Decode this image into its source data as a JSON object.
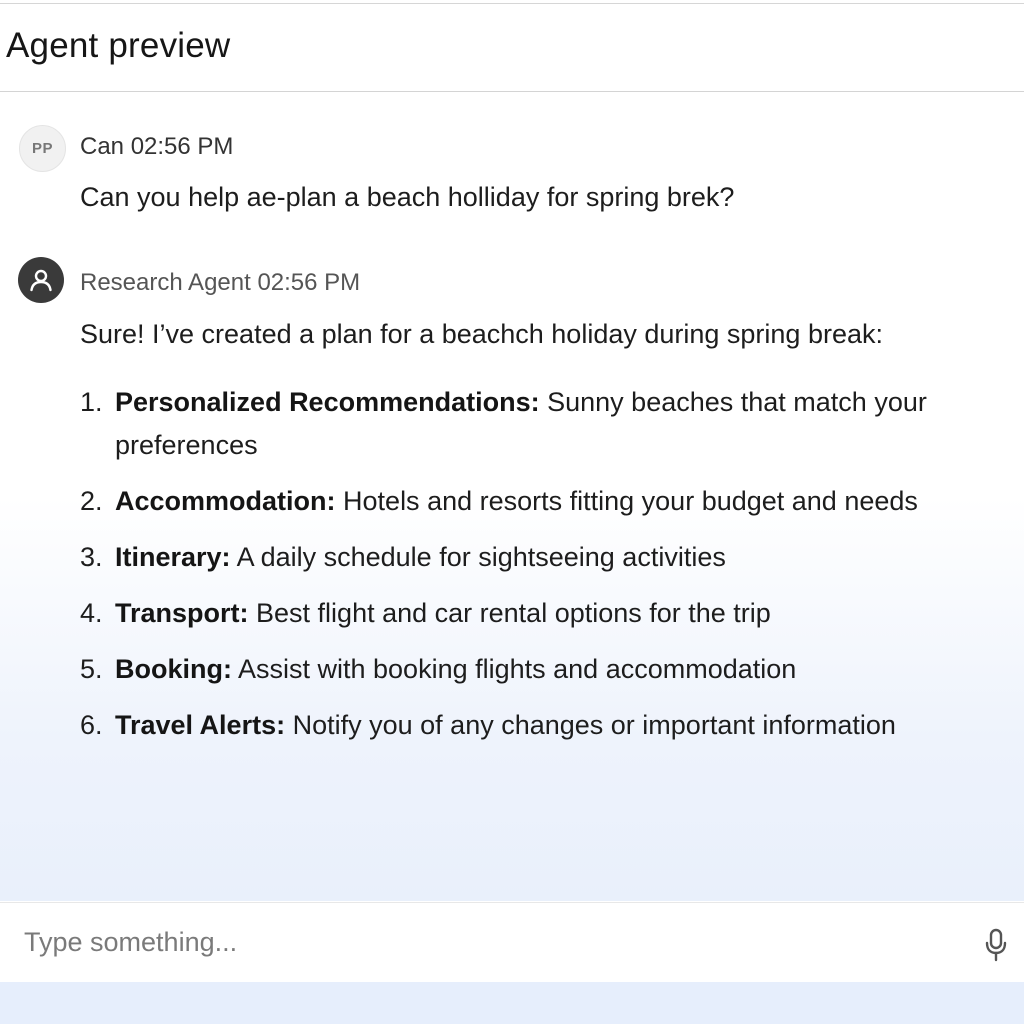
{
  "header": {
    "title": "Agent preview"
  },
  "messages": {
    "user": {
      "avatar_initials": "PP",
      "meta": "Can 02:56 PM",
      "text": "Can you help ae-plan a beach holliday for spring brek?"
    },
    "agent": {
      "avatar_icon": "person-icon",
      "meta": "Research Agent 02:56 PM",
      "intro": "Sure! I’ve created a plan for a beachch holiday during spring break:",
      "items": [
        {
          "num": "1.",
          "title": "Personalized Recommendations:",
          "text": "Sunny beaches that match your preferences"
        },
        {
          "num": "2.",
          "title": "Accommodation:",
          "text": "Hotels and resorts fitting your budget and needs"
        },
        {
          "num": "3.",
          "title": "Itinerary:",
          "text": "A daily schedule for sightseeing activities"
        },
        {
          "num": "4.",
          "title": "Transport:",
          "text": "Best flight and car rental options for the trip"
        },
        {
          "num": "5.",
          "title": "Booking:",
          "text": "Assist with booking flights and accommodation"
        },
        {
          "num": "6.",
          "title": "Travel Alerts:",
          "text": "Notify you of any changes or important information"
        }
      ]
    }
  },
  "composer": {
    "placeholder": "Type something...",
    "value": "",
    "mic_icon": "microphone-icon"
  },
  "colors": {
    "footer_bar": "#e6eefc",
    "agent_avatar": "#3a3a3a",
    "user_avatar": "#f1f1f1"
  }
}
